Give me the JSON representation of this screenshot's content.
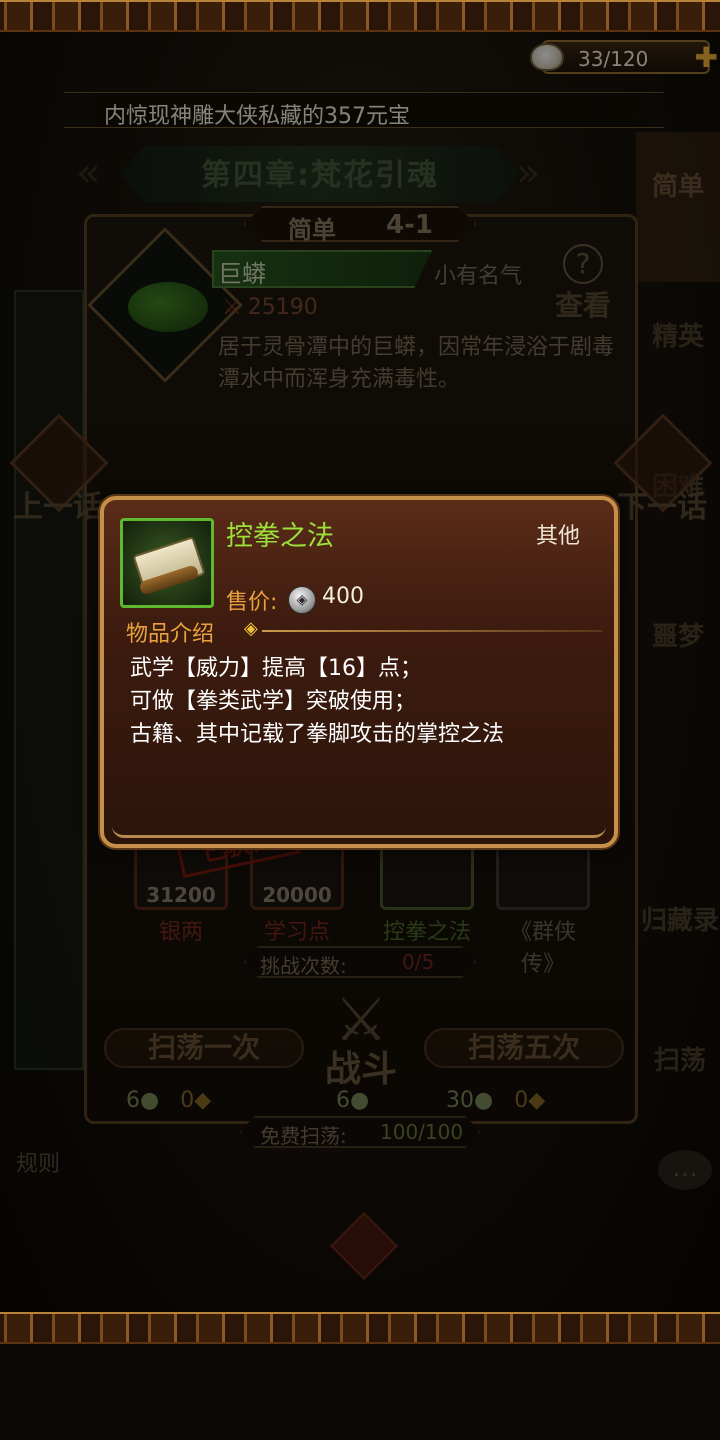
{
  "hud": {
    "stamina": "33/120"
  },
  "ticker": "内惊现神雕大侠私藏的357元宝",
  "chapter": {
    "title": "第四章:梵花引魂"
  },
  "difficulty_tabs": [
    "简单",
    "精英",
    "困难",
    "噩梦"
  ],
  "stage": {
    "difficulty": "简单",
    "level": "4-1"
  },
  "enemy": {
    "name": "巨蟒",
    "rank": "小有名气",
    "power": "25190",
    "description": "居于灵骨潭中的巨蟒，因常年浸浴于剧毒潭水中而浑身充满毒性。",
    "inspect_label": "查看"
  },
  "nav": {
    "prev": "上一话",
    "next": "下一话"
  },
  "rewards": [
    {
      "name": "银两",
      "amount": "31200"
    },
    {
      "name": "学习点",
      "amount": "20000"
    },
    {
      "name": "控拳之法",
      "amount": ""
    },
    {
      "name": "《群侠传》",
      "amount": ""
    }
  ],
  "obtained_stamp": "已获得",
  "attempts": {
    "label": "挑战次数:",
    "value": "0/5"
  },
  "buttons": {
    "sweep_once": "扫荡一次",
    "battle": "战斗",
    "sweep_five": "扫荡五次"
  },
  "costs": [
    {
      "stamina": "6",
      "gold": "0"
    },
    {
      "stamina": "6"
    },
    {
      "stamina": "30",
      "gold": "0"
    }
  ],
  "free_sweep": {
    "label": "免费扫荡:",
    "value": "100/100"
  },
  "side": {
    "collection": "归藏录",
    "sweep": "扫荡",
    "rules": "规则"
  },
  "popup": {
    "item_name": "控拳之法",
    "item_type": "其他",
    "price_label": "售价:",
    "price": "400",
    "desc_header": "物品介绍",
    "desc_lines": [
      "武学【威力】提高【16】点；",
      "可做【拳类武学】突破使用；",
      "古籍、其中记载了拳脚攻击的掌控之法"
    ]
  },
  "colors": {
    "item_name": "#9be13a",
    "accent": "#e9a23e",
    "frame": "#c7904a"
  }
}
